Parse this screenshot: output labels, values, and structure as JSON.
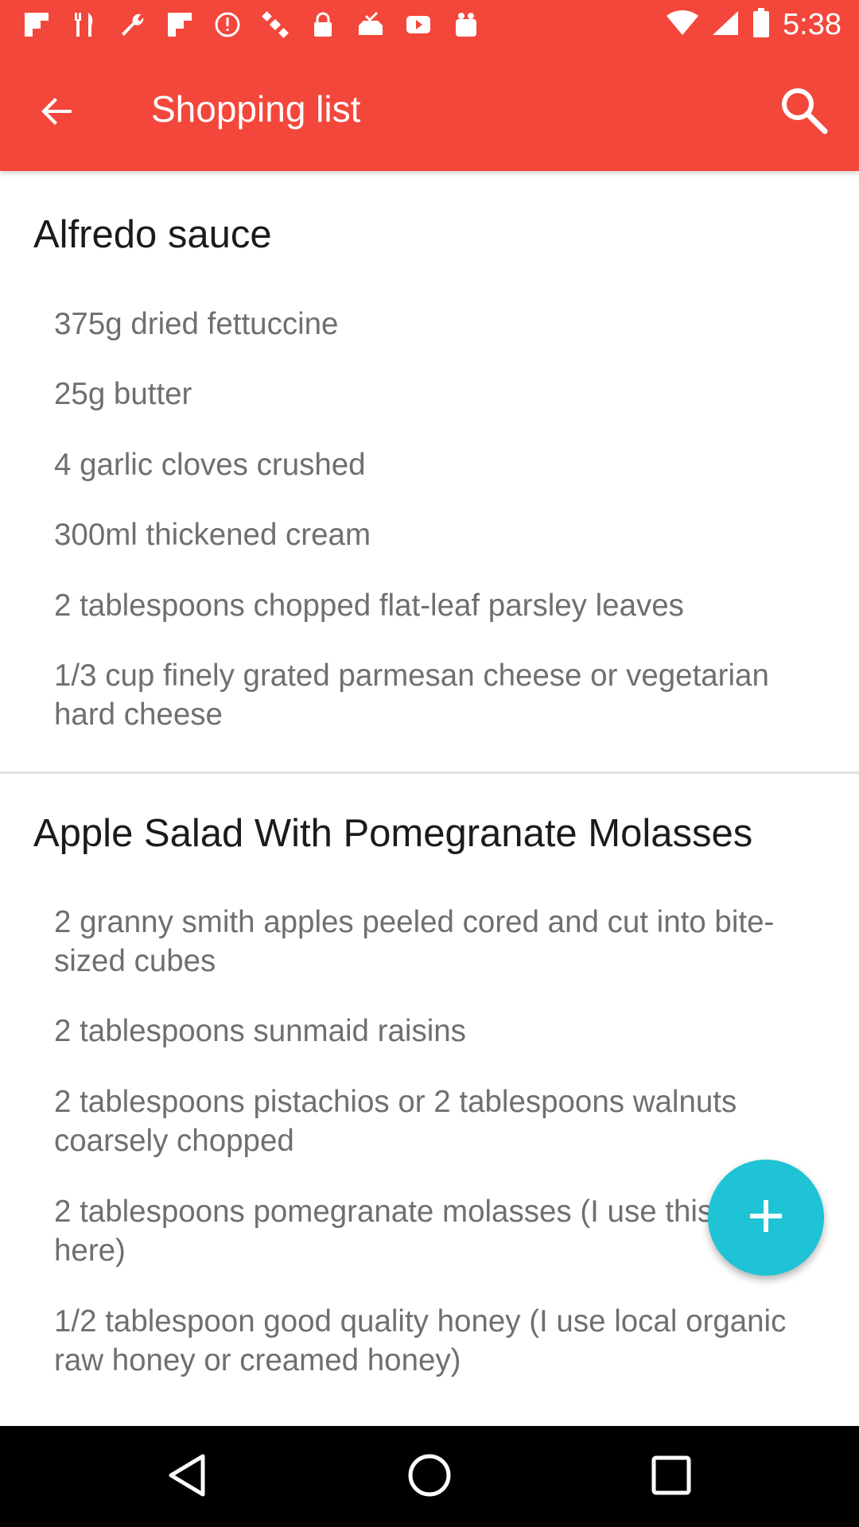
{
  "status_bar": {
    "time": "5:38",
    "notification_icons": [
      "flipboard-icon",
      "restaurant-icon",
      "wrench-icon",
      "flipboard-icon",
      "alert-icon",
      "satellite-icon",
      "lock-icon",
      "inbox-check-icon",
      "youtube-icon",
      "gift-icon"
    ],
    "right_icons": [
      "wifi-icon",
      "cellular-signal-icon",
      "battery-icon"
    ]
  },
  "app_bar": {
    "title": "Shopping list",
    "back_icon": "arrow-back-icon",
    "search_icon": "search-icon",
    "color": "#f3473c"
  },
  "sections": [
    {
      "title": "Alfredo sauce",
      "items": [
        "375g dried fettuccine",
        "25g butter",
        "4 garlic cloves crushed",
        "300ml thickened cream",
        "2 tablespoons chopped flat-leaf parsley leaves",
        "1/3 cup finely grated parmesan cheese or vegetarian hard cheese"
      ]
    },
    {
      "title": "Apple Salad With Pomegranate Molasses",
      "items": [
        "2 granny smith apples peeled cored and cut into bite-sized cubes",
        "2 tablespoons sunmaid raisins",
        "2 tablespoons pistachios or 2 tablespoons walnuts coarsely chopped",
        "2 tablespoons pomegranate molasses (I use this brand here)",
        "1/2 tablespoon good quality honey (I use local organic raw honey or creamed honey)"
      ]
    }
  ],
  "fab": {
    "icon": "plus-icon",
    "color": "#1ec3d5"
  },
  "nav_bar": {
    "icons": [
      "back-triangle-icon",
      "home-circle-icon",
      "recents-square-icon"
    ]
  }
}
